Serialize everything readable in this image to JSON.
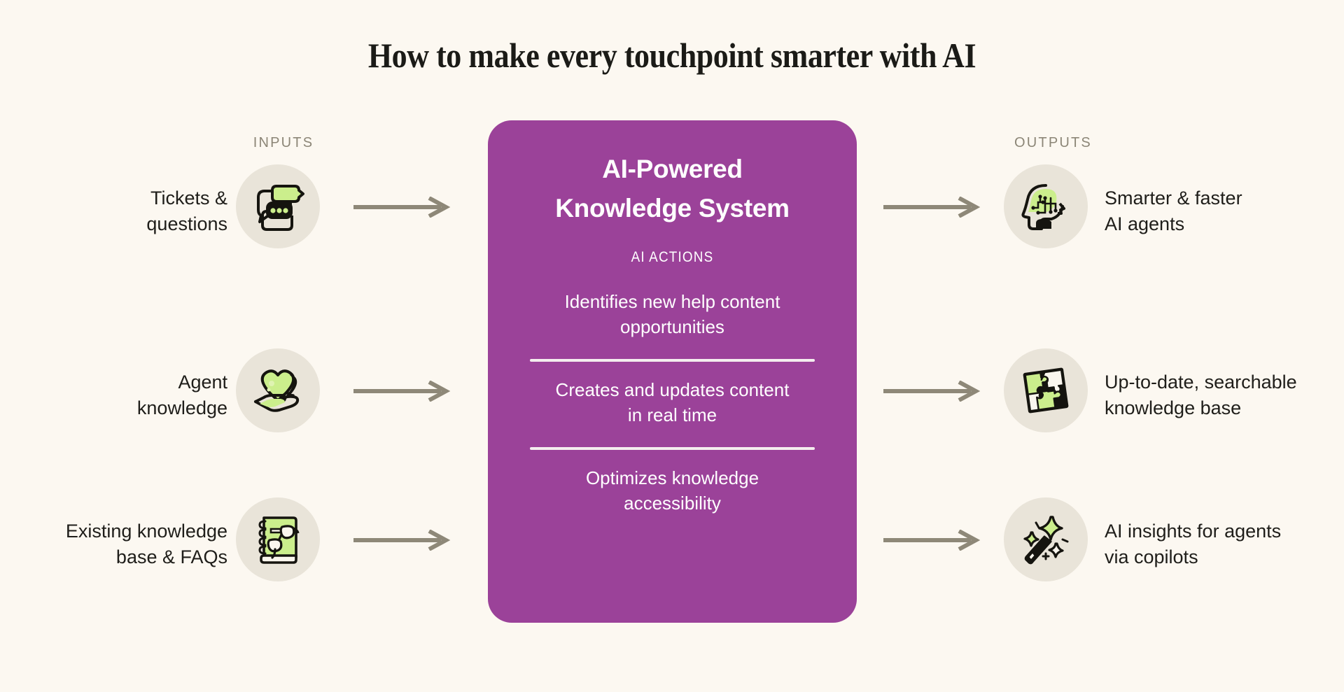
{
  "title": "How to make every touchpoint smarter with AI",
  "colors": {
    "background": "#FCF8F1",
    "card_purple": "#9B4299",
    "icon_circle": "#E9E4D9",
    "arrow": "#8E8878",
    "accent_green": "#CBEE8C",
    "label_gray": "#8C8677",
    "text_dark": "#1F1E1A"
  },
  "columns": {
    "inputs_header": "INPUTS",
    "outputs_header": "OUTPUTS"
  },
  "inputs": [
    {
      "label": "Tickets &\nquestions",
      "line1": "Tickets &",
      "line2": "questions",
      "icon": "chat-bubbles-icon"
    },
    {
      "label": "Agent\nknowledge",
      "line1": "Agent",
      "line2": "knowledge",
      "icon": "hand-heart-icon"
    },
    {
      "label": "Existing knowledge\nbase & FAQs",
      "line1": "Existing knowledge",
      "line2": "base & FAQs",
      "icon": "notebook-glasses-icon"
    }
  ],
  "outputs": [
    {
      "line1": "Smarter & faster",
      "line2": "AI agents",
      "icon": "ai-brain-head-icon"
    },
    {
      "line1": "Up-to-date, searchable",
      "line2": "knowledge base",
      "icon": "puzzle-pieces-icon"
    },
    {
      "line1": "AI insights for agents",
      "line2": "via copilots",
      "icon": "magic-wand-icon"
    }
  ],
  "card": {
    "title_line1": "AI-Powered",
    "title_line2": "Knowledge System",
    "subtitle": "AI ACTIONS",
    "actions": [
      {
        "line1": "Identifies new help content",
        "line2": "opportunities"
      },
      {
        "line1": "Creates and updates content",
        "line2": "in real time"
      },
      {
        "line1": "Optimizes knowledge",
        "line2": "accessibility"
      }
    ]
  },
  "arrows": {
    "direction": "right",
    "count": 6
  }
}
